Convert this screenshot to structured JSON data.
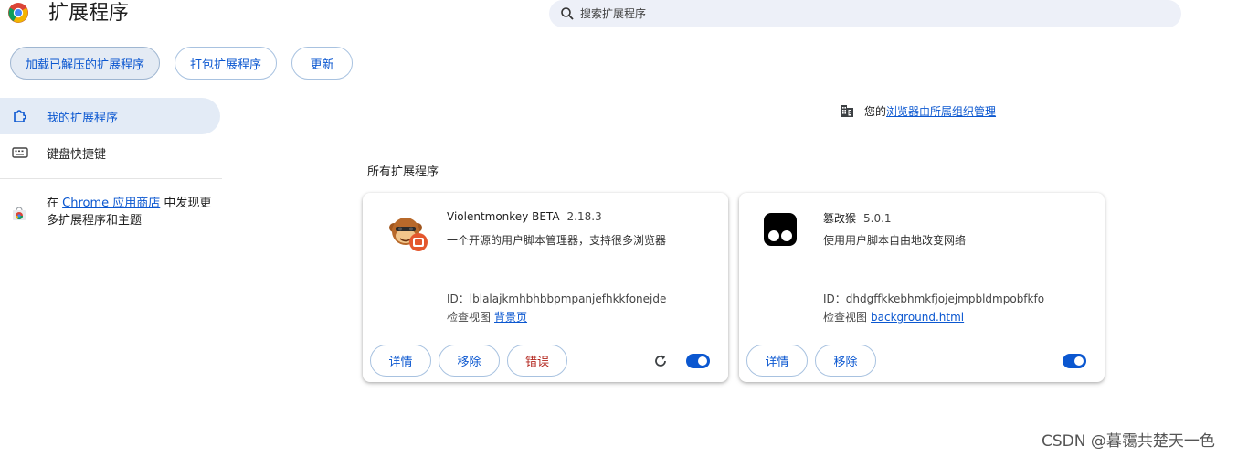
{
  "header": {
    "title": "扩展程序",
    "search_placeholder": "搜索扩展程序"
  },
  "toolbar": {
    "load_unpacked": "加载已解压的扩展程序",
    "pack": "打包扩展程序",
    "update": "更新"
  },
  "sidebar": {
    "items": [
      {
        "label": "我的扩展程序",
        "icon": "puzzle-icon",
        "active": true
      },
      {
        "label": "键盘快捷键",
        "icon": "keyboard-icon",
        "active": false
      }
    ],
    "promo": {
      "prefix": "在 ",
      "link": "Chrome 应用商店",
      "suffix": " 中发现更多扩展程序和主题"
    }
  },
  "managed": {
    "prefix": "您的",
    "link": "浏览器由所属组织管理"
  },
  "section_title": "所有扩展程序",
  "extensions": [
    {
      "name": "Violentmonkey BETA",
      "version": "2.18.3",
      "description": "一个开源的用户脚本管理器，支持很多浏览器",
      "id": "ID：lblalajkmhbhbbpmpanjefhkkfonejde",
      "inspect_label": "检查视图",
      "inspect_link": "背景页",
      "buttons": [
        "详情",
        "移除",
        "错误"
      ],
      "has_reload": true,
      "enabled": true
    },
    {
      "name": "篡改猴",
      "version": "5.0.1",
      "description": "使用用户脚本自由地改变网络",
      "id": "ID：dhdgffkkebhmkfjojejmpbldmpobfkfo",
      "inspect_label": "检查视图",
      "inspect_link": "background.html",
      "buttons": [
        "详情",
        "移除"
      ],
      "has_reload": false,
      "enabled": true
    }
  ],
  "watermark": "CSDN @暮霭共楚天一色",
  "colors": {
    "accent": "#0b57d0",
    "error": "#b3261e",
    "active_bg": "#e3ebf6"
  }
}
